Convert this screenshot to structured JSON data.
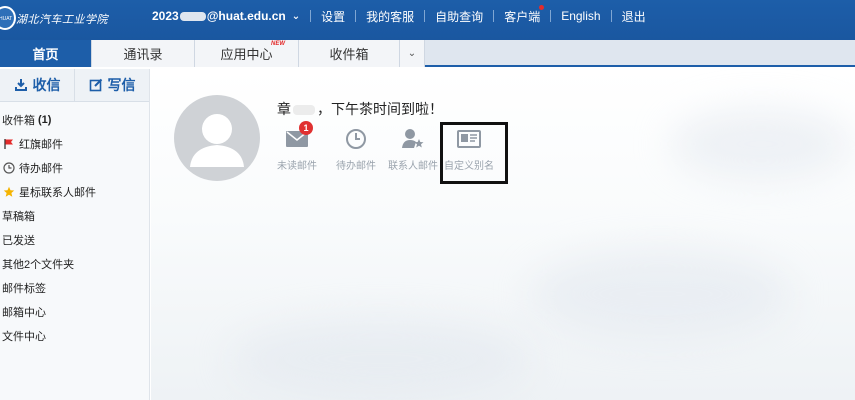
{
  "header": {
    "logo_text": "湖北汽车工业学院",
    "account_prefix": "2023",
    "account_suffix": "@huat.edu.cn",
    "links": [
      "设置",
      "我的客服",
      "自助查询",
      "客户端",
      "English",
      "退出"
    ]
  },
  "tabs": [
    {
      "label": "首页",
      "active": true
    },
    {
      "label": "通讯录"
    },
    {
      "label": "应用中心",
      "badge": "NEW"
    },
    {
      "label": "收件箱"
    }
  ],
  "sidebar": {
    "receive_label": "收信",
    "write_label": "写信",
    "folders": [
      {
        "label": "收件箱",
        "count": "(1)",
        "icon": "none"
      },
      {
        "label": "红旗邮件",
        "icon": "red-flag-icon"
      },
      {
        "label": "待办邮件",
        "icon": "clock-icon"
      },
      {
        "label": "星标联系人邮件",
        "icon": "star-icon"
      },
      {
        "label": "草稿箱",
        "icon": "none"
      },
      {
        "label": "已发送",
        "icon": "none"
      },
      {
        "label": "其他2个文件夹",
        "icon": "none"
      },
      {
        "label": "邮件标签",
        "icon": "none"
      },
      {
        "label": "邮箱中心",
        "icon": "none"
      },
      {
        "label": "文件中心",
        "icon": "none"
      }
    ]
  },
  "main": {
    "greeting_prefix": "章",
    "greeting_suffix": "，下午茶时间到啦！",
    "quick_actions": [
      {
        "label": "未读邮件",
        "badge": "1",
        "icon": "envelope-icon"
      },
      {
        "label": "待办邮件",
        "icon": "clock-icon"
      },
      {
        "label": "联系人邮件",
        "icon": "contact-star-icon"
      },
      {
        "label": "自定义别名",
        "icon": "id-card-icon"
      }
    ]
  },
  "colors": {
    "brand_blue": "#1d5ea9",
    "badge_red": "#e03131",
    "icon_gray": "#9aa3ad"
  }
}
